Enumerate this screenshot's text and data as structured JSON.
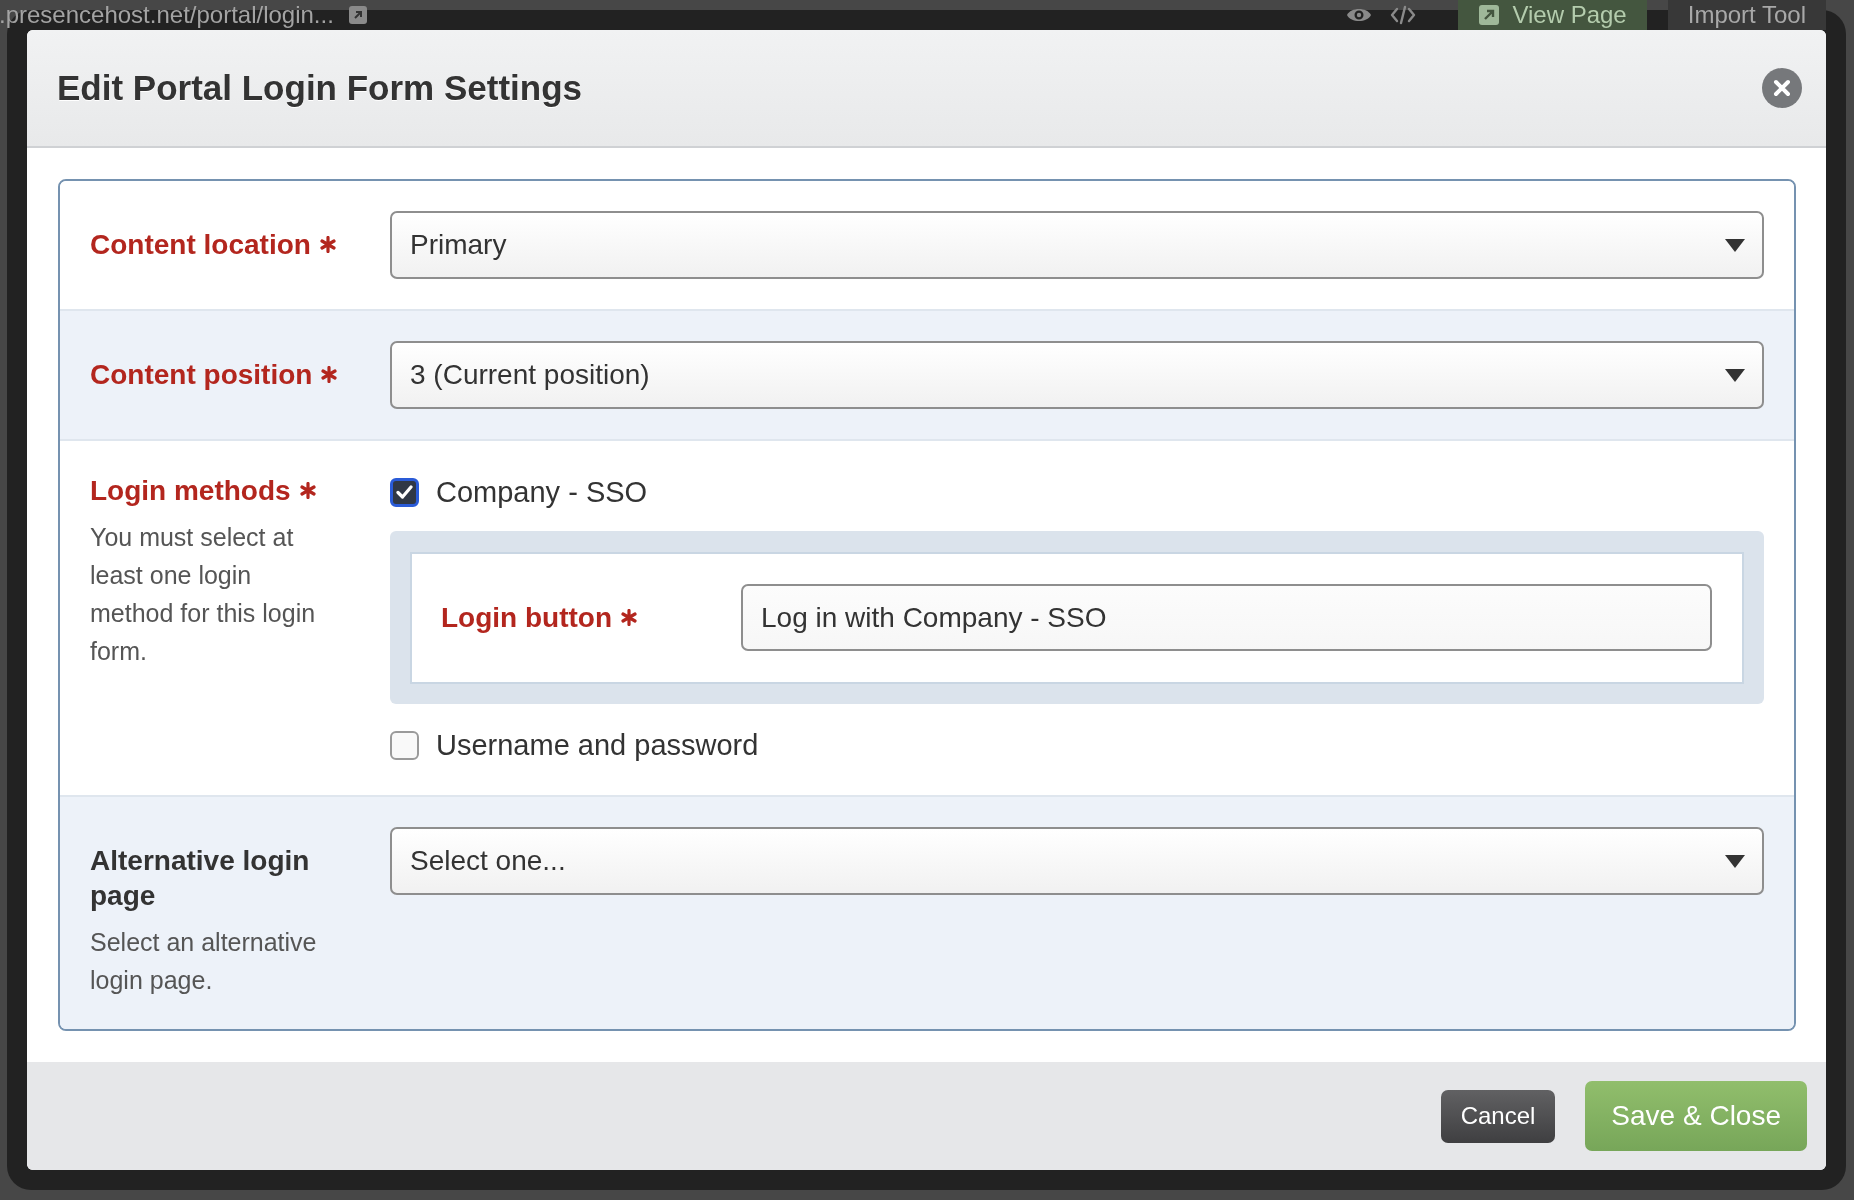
{
  "background_page": {
    "address": ".presencehost.net/portal/login...",
    "buttons": [
      {
        "label": "View Page",
        "kind": "accent"
      },
      {
        "label": "Import Tool",
        "kind": "plain"
      }
    ]
  },
  "dialog": {
    "title": "Edit Portal Login Form Settings",
    "fields": [
      {
        "kind": "select",
        "label": "Content location",
        "required": true,
        "value": "Primary"
      },
      {
        "kind": "select",
        "label": "Content position",
        "required": true,
        "value": "3 (Current position)"
      },
      {
        "kind": "checkboxes",
        "label": "Login methods",
        "required": true,
        "help": "You must select at least one login method for this login form.",
        "options": [
          {
            "label": "Company - SSO",
            "checked": true,
            "subfield": {
              "label": "Login button",
              "required": true,
              "value": "Log in with Company - SSO"
            }
          },
          {
            "label": "Username and password",
            "checked": false
          }
        ]
      },
      {
        "kind": "select",
        "label": "Alternative login page",
        "required": false,
        "value": "Select one...",
        "help": "Select an alternative login page."
      }
    ],
    "buttons": [
      {
        "label": "Cancel",
        "kind": "cancel"
      },
      {
        "label": "Save & Close",
        "kind": "save"
      }
    ]
  }
}
